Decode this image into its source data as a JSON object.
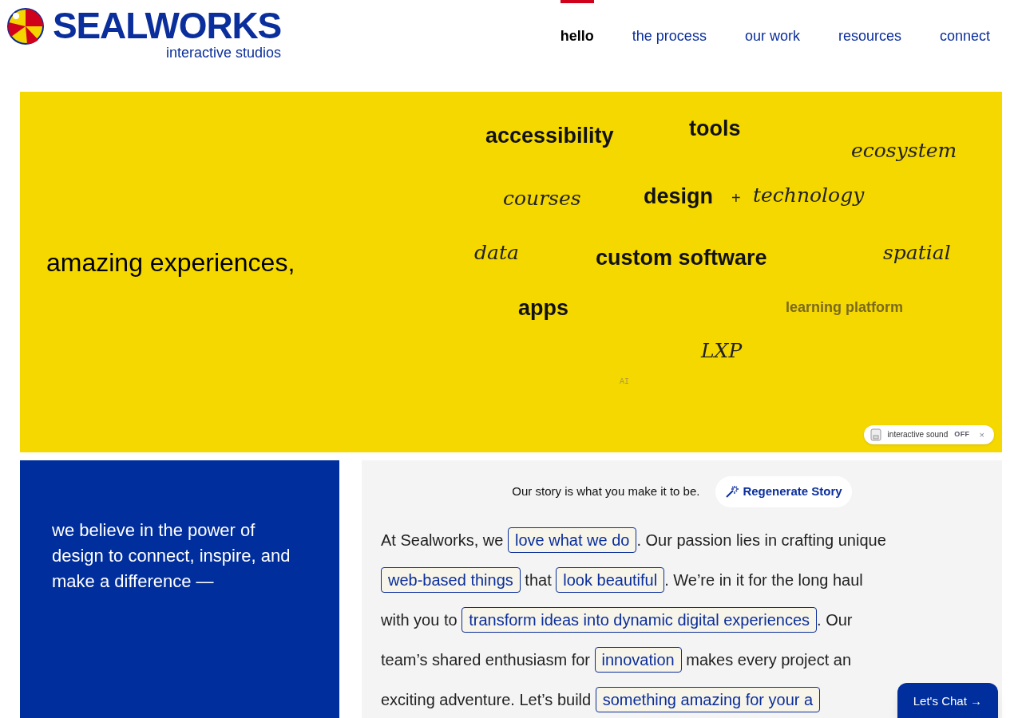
{
  "logo": {
    "name": "SEALWORKS",
    "tagline": "interactive studios"
  },
  "nav": [
    {
      "label": "hello",
      "selected": true
    },
    {
      "label": "the process",
      "selected": false
    },
    {
      "label": "our work",
      "selected": false
    },
    {
      "label": "resources",
      "selected": false
    },
    {
      "label": "connect",
      "selected": false
    }
  ],
  "hero": {
    "headline": "amazing experiences,",
    "words": [
      {
        "text": "accessibility",
        "kind": "bold"
      },
      {
        "text": "tools",
        "kind": "bold"
      },
      {
        "text": "ecosystem",
        "kind": "script"
      },
      {
        "text": "courses",
        "kind": "script"
      },
      {
        "text": "design",
        "kind": "bold"
      },
      {
        "text": "+",
        "kind": "plus"
      },
      {
        "text": "technology",
        "kind": "script"
      },
      {
        "text": "data",
        "kind": "script"
      },
      {
        "text": "custom software",
        "kind": "bold"
      },
      {
        "text": "spatial",
        "kind": "script"
      },
      {
        "text": "apps",
        "kind": "bold"
      },
      {
        "text": "learning platform",
        "kind": "muted"
      },
      {
        "text": "LXP",
        "kind": "script"
      },
      {
        "text": "AI",
        "kind": "tiny"
      }
    ],
    "sound": {
      "label": "interactive sound",
      "status": "OFF",
      "close": "×"
    }
  },
  "mission": "we believe in the power of design to connect, inspire, and make a difference —",
  "story": {
    "prompt": "Our story is what you make it to be.",
    "button": "Regenerate Story",
    "lines": [
      [
        {
          "text": "At Sealworks, we ",
          "kind": "text"
        },
        {
          "text": "love what we do",
          "kind": "highlight"
        },
        {
          "text": ". Our passion lies in crafting unique",
          "kind": "text"
        }
      ],
      [
        {
          "text": "web-based things",
          "kind": "highlight"
        },
        {
          "text": " that ",
          "kind": "text"
        },
        {
          "text": "look beautiful",
          "kind": "highlight"
        },
        {
          "text": ". We’re in it for the long haul",
          "kind": "text"
        }
      ],
      [
        {
          "text": "with you to ",
          "kind": "text"
        },
        {
          "text": "transform ideas into dynamic digital experiences",
          "kind": "highlight"
        },
        {
          "text": ". Our",
          "kind": "text"
        }
      ],
      [
        {
          "text": "team’s shared enthusiasm for ",
          "kind": "text"
        },
        {
          "text": "innovation",
          "kind": "highlight"
        },
        {
          "text": " makes every project an",
          "kind": "text"
        }
      ],
      [
        {
          "text": "exciting adventure. Let’s build ",
          "kind": "text"
        },
        {
          "text": "something amazing for your a",
          "kind": "highlight"
        }
      ]
    ]
  },
  "chat": {
    "label": "Let's Chat →"
  }
}
